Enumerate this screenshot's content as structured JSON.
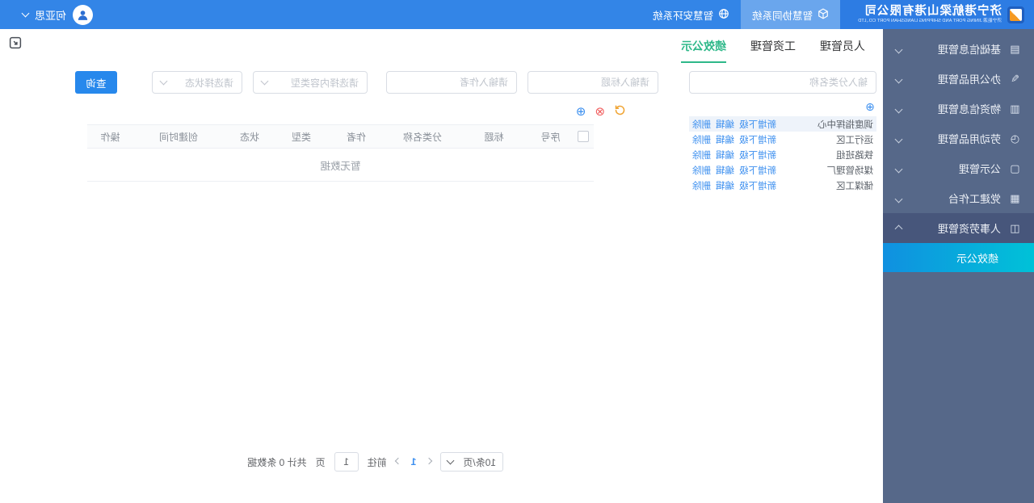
{
  "header": {
    "logo": {
      "title": "济宁港航梁山港有限公司",
      "subtitle": "济宁能源  JINING PORT AND SHIPPING LIANGSHAN PORT CO.,LTD"
    },
    "systems": [
      {
        "label": "智慧协同系统",
        "icon": "cube-icon",
        "active": true
      },
      {
        "label": "智慧安环系统",
        "icon": "globe-icon",
        "active": false
      }
    ],
    "user": {
      "name": "何亚思"
    }
  },
  "sidebar": {
    "items": [
      {
        "label": "基础信息管理",
        "icon": "archive-icon",
        "glyph": "▤"
      },
      {
        "label": "办公用品管理",
        "icon": "pencil-icon",
        "glyph": "✎"
      },
      {
        "label": "物资信息管理",
        "icon": "materials-icon",
        "glyph": "▥"
      },
      {
        "label": "劳动用品管理",
        "icon": "clock-icon",
        "glyph": "◷"
      },
      {
        "label": "公示管理",
        "icon": "document-icon",
        "glyph": "▢"
      },
      {
        "label": "党建工作台",
        "icon": "grid-icon",
        "glyph": "▦"
      },
      {
        "label": "人事劳资管理",
        "icon": "people-icon",
        "glyph": "◫",
        "active": true,
        "expanded": true,
        "children": [
          {
            "label": "绩效公示",
            "active": true
          }
        ]
      }
    ]
  },
  "content": {
    "tabs": [
      {
        "label": "人员管理",
        "active": false
      },
      {
        "label": "工资管理",
        "active": false
      },
      {
        "label": "绩效公示",
        "active": true
      }
    ],
    "tree": {
      "search_placeholder": "输入分类名称",
      "add_glyph": "⊕",
      "nodes": [
        {
          "name": "调度指挥中心",
          "selected": true
        },
        {
          "name": "运行工区",
          "selected": false
        },
        {
          "name": "铁路班组",
          "selected": false
        },
        {
          "name": "煤场管理厂",
          "selected": false
        },
        {
          "name": "储煤工区",
          "selected": false
        }
      ],
      "node_actions": [
        "新增下级",
        "编辑",
        "删除"
      ]
    },
    "filters": {
      "title_placeholder": "请输入标题",
      "author_placeholder": "请输入作者",
      "content_type_placeholder": "请选择内容类型",
      "status_placeholder": "请选择状态",
      "search_button": "查询"
    },
    "toolbar": {
      "delete_glyph": "⊗",
      "add_glyph": "⊕"
    },
    "table": {
      "columns": [
        "序号",
        "标题",
        "分类名称",
        "作者",
        "类型",
        "状态",
        "创建时间",
        "操作"
      ],
      "empty_text": "暂无数据"
    },
    "pagination": {
      "page_size": "10条/页",
      "current_page": "1",
      "goto_prefix": "前往",
      "goto_value": "1",
      "goto_suffix": "页",
      "total_text": "共计 0 条数据"
    }
  },
  "colors": {
    "topbar": "#3385e7",
    "logo_block": "#2d7ce3",
    "sidebar": "#566889",
    "sidebar_active": "#47567b",
    "submenu_gradient": "#00c2d8 → #1090e0",
    "primary": "#2788ec",
    "link": "#3a8eef",
    "tab_active": "#2eb889",
    "danger": "#f05b5b",
    "warning": "#f0a22e"
  }
}
